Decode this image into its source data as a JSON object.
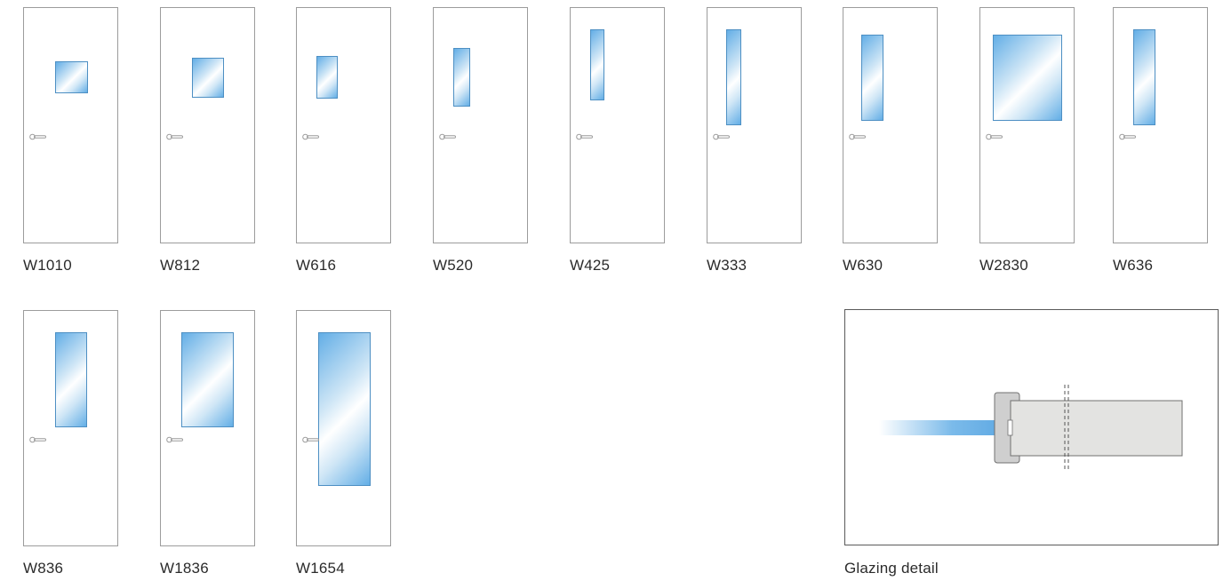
{
  "doors": [
    {
      "code": "W1010"
    },
    {
      "code": "W812"
    },
    {
      "code": "W616"
    },
    {
      "code": "W520"
    },
    {
      "code": "W425"
    },
    {
      "code": "W333"
    },
    {
      "code": "W630"
    },
    {
      "code": "W2830"
    },
    {
      "code": "W636"
    },
    {
      "code": "W836"
    },
    {
      "code": "W1836"
    },
    {
      "code": "W1654"
    }
  ],
  "detail": {
    "label": "Glazing detail"
  },
  "colors": {
    "door_outline": "#9c9c9c",
    "glass_edge": "#4d8fc3",
    "glass_blue": "#63aee6",
    "frame_fill": "#e3e3e1",
    "bead_fill": "#cfcfcf"
  }
}
